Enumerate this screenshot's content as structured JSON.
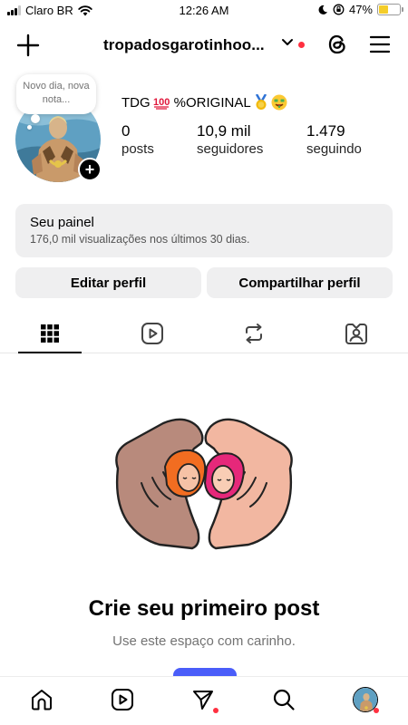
{
  "status_bar": {
    "carrier": "Claro BR",
    "time": "12:26 AM",
    "battery_percent": "47%",
    "battery_level": 0.47,
    "icons": [
      "signal-icon",
      "wifi-icon",
      "moon-icon",
      "orientation-lock-icon",
      "battery-icon"
    ]
  },
  "header": {
    "username": "tropadosgarotinhoo...",
    "icons": [
      "plus-icon",
      "chevron-down-icon",
      "threads-icon",
      "menu-icon"
    ],
    "notification_color": "#ff3040"
  },
  "profile": {
    "note": "Novo dia, nova nota...",
    "display_name": "TDG",
    "display_name_suffix": "%ORIGINAL",
    "stats": [
      {
        "value": "0",
        "label": "posts"
      },
      {
        "value": "10,9 mil",
        "label": "seguidores"
      },
      {
        "value": "1.479",
        "label": "seguindo"
      }
    ]
  },
  "dashboard": {
    "title": "Seu painel",
    "subtitle": "176,0 mil visualizações nos últimos 30 dias."
  },
  "actions": {
    "edit_label": "Editar perfil",
    "share_label": "Compartilhar perfil"
  },
  "tabs": [
    "grid-icon",
    "reels-icon",
    "reposts-icon",
    "tagged-icon"
  ],
  "empty_state": {
    "title": "Crie seu primeiro post",
    "subtitle": "Use este espaço com carinho."
  },
  "bottom_nav": [
    "home-icon",
    "reels-icon",
    "direct-icon",
    "search-icon",
    "profile-avatar"
  ],
  "colors": {
    "accent_blue": "#4a5df9",
    "notification_red": "#ff3040",
    "button_gray": "#efeff0"
  }
}
